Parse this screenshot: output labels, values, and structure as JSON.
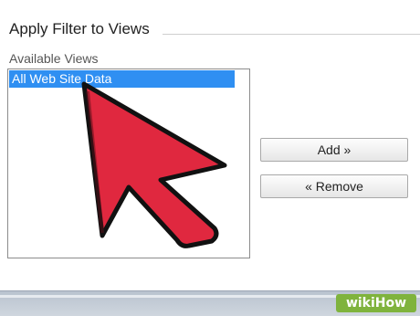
{
  "filter_panel": {
    "title": "Apply Filter to Views",
    "views_label": "Available Views",
    "available_views": [
      "All Web Site Data"
    ],
    "selected_view": "All Web Site Data",
    "add_button": "Add »",
    "remove_button": "« Remove"
  },
  "overlay": {
    "pointer": "arrow-cursor-icon",
    "pointer_color": "#e0283f",
    "watermark": "wikiHow"
  },
  "colors": {
    "selection": "#2f8ff2"
  }
}
